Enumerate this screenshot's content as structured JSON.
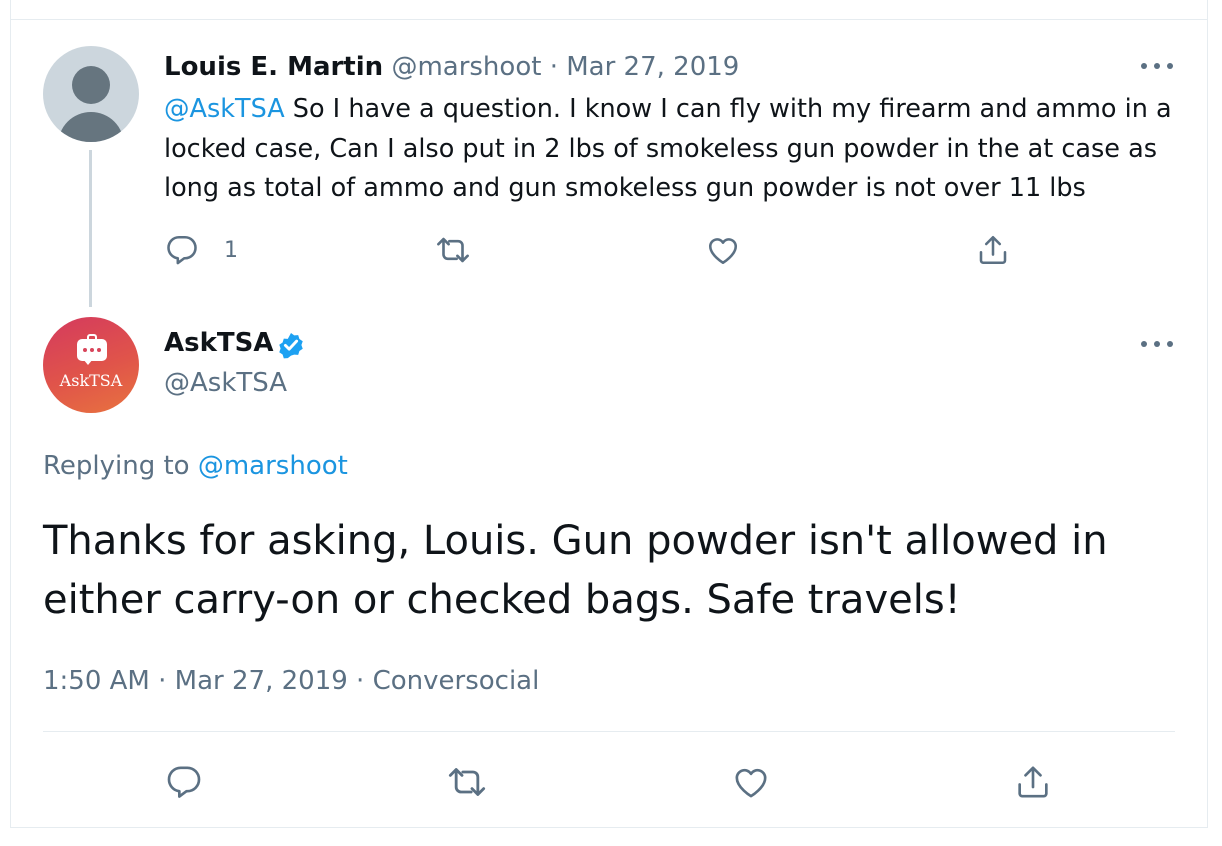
{
  "parent_tweet": {
    "author_name": "Louis E. Martin",
    "author_handle": "@marshoot",
    "dot": "·",
    "date": "Mar 27, 2019",
    "mention": "@AskTSA",
    "text": " So I have a question. I know I can fly with my firearm and ammo in a locked case, Can I also put in 2 lbs of smokeless gun powder in the at case as long as total of ammo and gun smokeless gun powder is not over 11 lbs",
    "reply_count": "1",
    "icons": [
      "reply-icon",
      "retweet-icon",
      "like-icon",
      "share-icon"
    ]
  },
  "reply_tweet": {
    "author_name": "AskTSA",
    "author_handle": "@AskTSA",
    "avatar_text": "AskTSA",
    "replying_prefix": "Replying to ",
    "replying_to": "@marshoot",
    "text": "Thanks for asking, Louis. Gun powder isn't allowed in either carry-on or checked bags. Safe travels!",
    "time": "1:50 AM",
    "dot": "·",
    "date": "Mar 27, 2019",
    "source": "Conversocial",
    "icons": [
      "reply-icon",
      "retweet-icon",
      "like-icon",
      "share-icon"
    ]
  },
  "colors": {
    "link": "#1b95e0",
    "secondary": "#5b7083",
    "primary_text": "#0f1419",
    "verified": "#1da1f2"
  }
}
